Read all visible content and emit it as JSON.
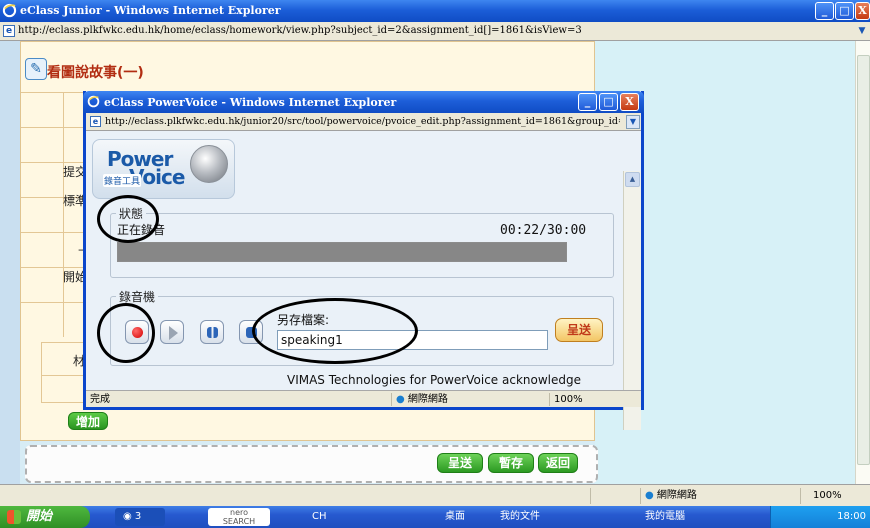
{
  "outer_window": {
    "title": "eClass Junior - Windows Internet Explorer",
    "url": "http://eclass.plkfwkc.edu.hk/home/eclass/homework/view.php?subject_id=2&assignment_id[]=1861&isView=3",
    "controls": {
      "minimize": "_",
      "maximize": "□",
      "close": "X"
    }
  },
  "homework_page": {
    "title": "看圖說故事(一)",
    "row_labels": [
      "提交",
      "標準",
      "上",
      "開始",
      "材"
    ],
    "add_button": "增加",
    "buttons": {
      "submit": "呈送",
      "save": "暫存",
      "back": "返回"
    }
  },
  "outer_status": {
    "zone": "網際網路",
    "zoom": "100%"
  },
  "taskbar": {
    "start": "開始",
    "ie_group": "3",
    "nero_top": "nero",
    "nero_bottom": "SEARCH",
    "lang": "CH",
    "desktop": "桌面",
    "my_documents": "我的文件",
    "my_computer": "我的電腦",
    "clock": "18:00"
  },
  "popup_window": {
    "title": "eClass PowerVoice - Windows Internet Explorer",
    "url": "http://eclass.plkfwkc.edu.hk/junior20/src/tool/powervoice/pvoice_edit.php?assignment_id=1861&group_id=0&worktype=",
    "logo": {
      "power": "Power",
      "voice": "Voice",
      "tag": "錄音工具"
    },
    "status_legend": "狀態",
    "status_text": "正在錄音",
    "timer": "00:22/30:00",
    "progress_fraction": 0.0122,
    "recorder_legend": "錄音機",
    "save_as_label": "另存檔案:",
    "filename": "speaking1",
    "submit_button": "呈送",
    "credits": "VIMAS Technologies for PowerVoice acknowledge",
    "status_bar": {
      "done": "完成",
      "zone": "網際網路",
      "zoom": "100%"
    }
  },
  "colors": {
    "title_bar": "#1c5ed8",
    "record_red": "#d40000",
    "green_button": "#2c9a22",
    "title_red": "#b22d12"
  },
  "icons": [
    "ie-icon",
    "page-icon",
    "record-icon",
    "play-icon",
    "pause-icon",
    "stop-icon",
    "microphone-icon",
    "globe-icon",
    "windows-flag-icon"
  ]
}
